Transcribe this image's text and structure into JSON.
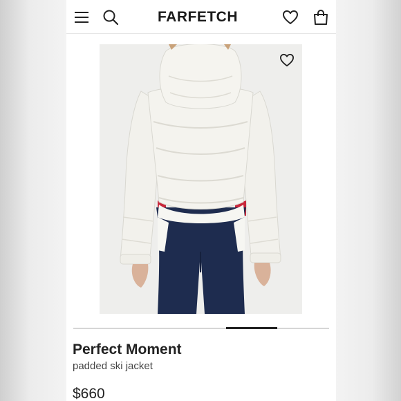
{
  "header": {
    "logo": "FARFETCH",
    "icons": [
      "menu-icon",
      "search-icon",
      "heart-icon",
      "shopping-bag-icon"
    ]
  },
  "product": {
    "brand": "Perfect Moment",
    "description": "padded ski jacket",
    "price": "$660",
    "gallery_position": "4 of 5",
    "colors": {
      "jacket": "#f4f3ee",
      "leggings": "#1e2c4f",
      "accent_red": "#c8263a"
    }
  },
  "theme": {
    "text": "#222222",
    "divider": "#e6e6e6"
  }
}
